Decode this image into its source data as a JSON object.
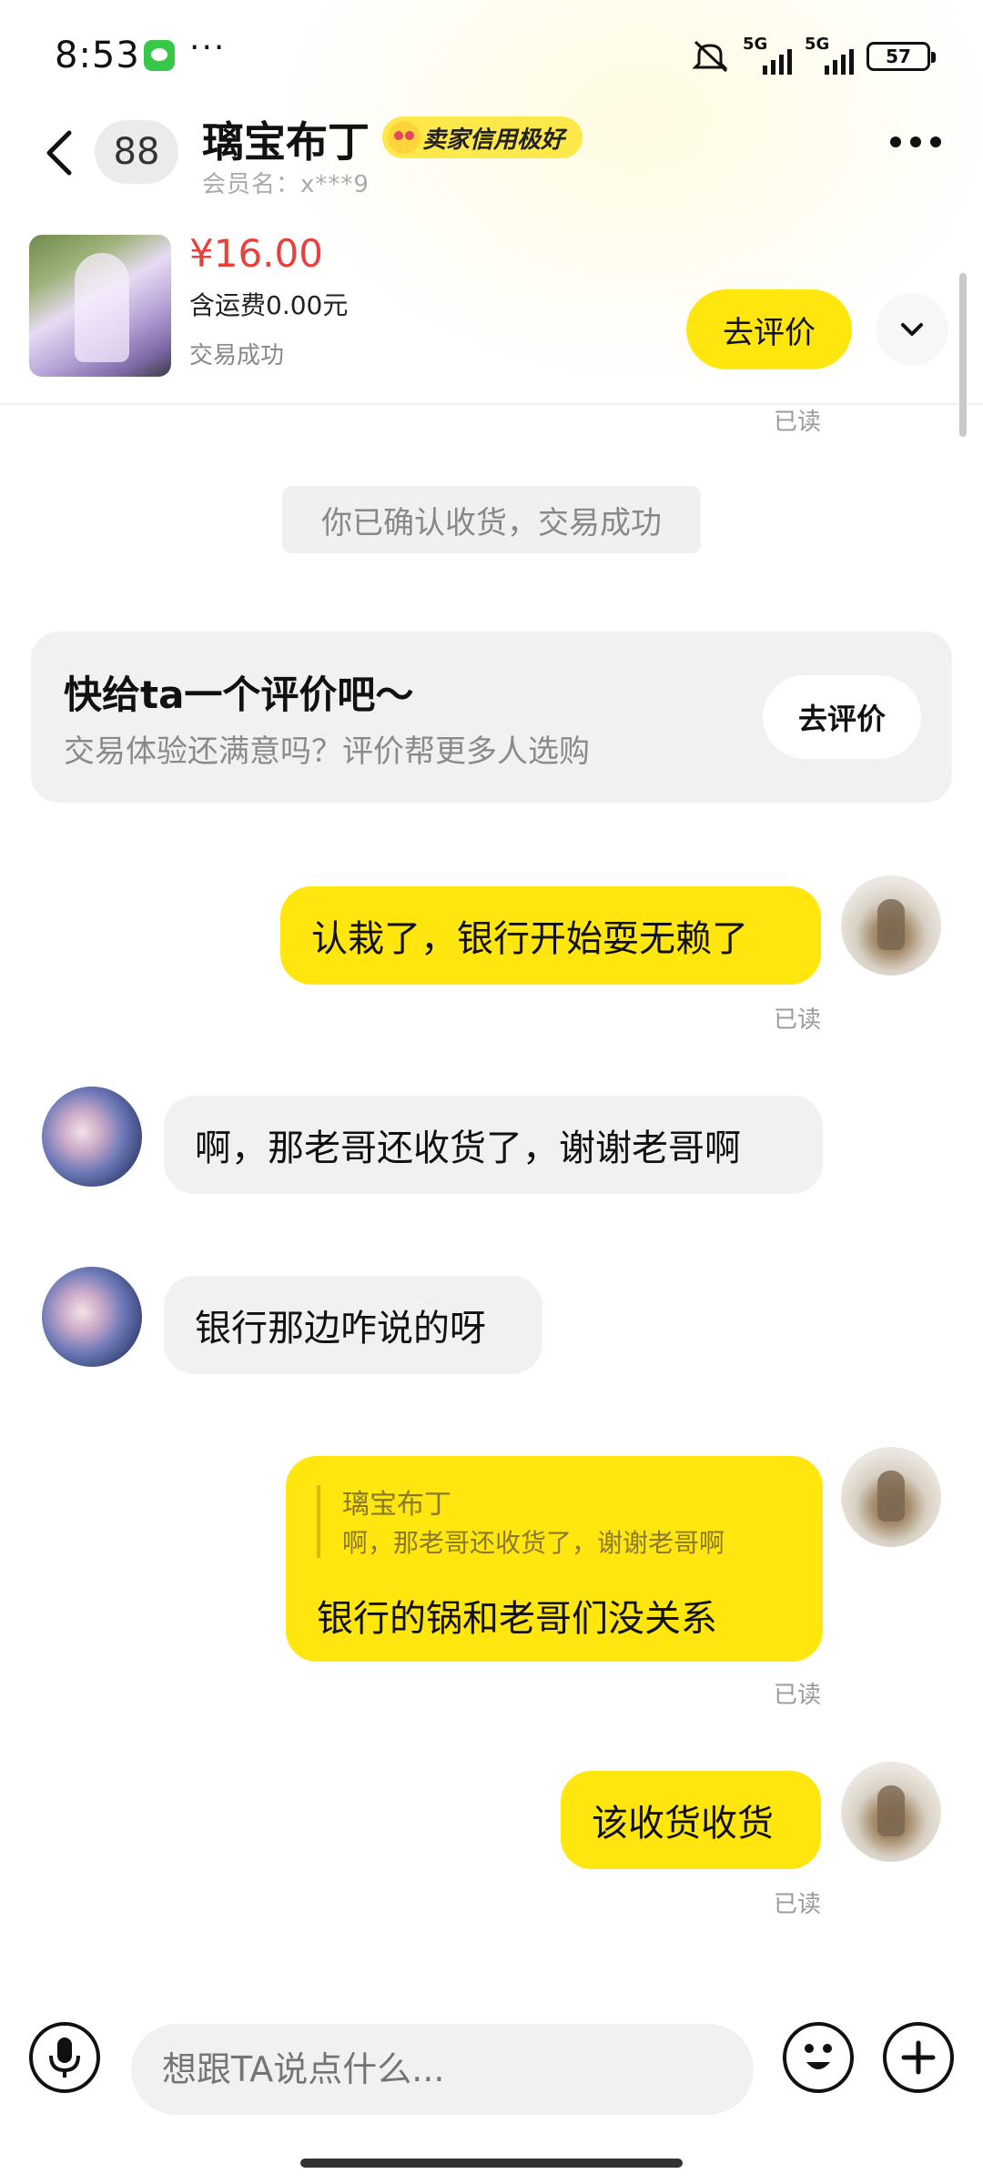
{
  "status_bar": {
    "time": "8:53",
    "more": "···",
    "signal1": "5G",
    "signal2": "5G",
    "battery": "57"
  },
  "header": {
    "unread_count": "88",
    "seller_name": "璃宝布丁",
    "credit_badge": "卖家信用极好",
    "member_label": "会员名：x***9"
  },
  "product": {
    "price": "¥16.00",
    "shipping": "含运费0.00元",
    "status": "交易成功",
    "review_button": "去评价"
  },
  "chat": {
    "read_label": "已读",
    "system_message": "你已确认收货，交易成功",
    "prompt": {
      "title": "快给ta一个评价吧～",
      "subtitle": "交易体验还满意吗？评价帮更多人选购",
      "button": "去评价"
    },
    "messages": [
      {
        "sender": "me",
        "text": "认栽了，银行开始耍无赖了"
      },
      {
        "sender": "them",
        "text": "啊，那老哥还收货了，谢谢老哥啊"
      },
      {
        "sender": "them",
        "text": "银行那边咋说的呀"
      },
      {
        "sender": "me",
        "quote_name": "璃宝布丁",
        "quote_text": "啊，那老哥还收货了，谢谢老哥啊",
        "text": "银行的锅和老哥们没关系"
      },
      {
        "sender": "me",
        "text": "该收货收货"
      }
    ]
  },
  "input": {
    "placeholder": "想跟TA说点什么..."
  },
  "colors": {
    "accent_yellow": "#ffe60f",
    "price_red": "#e8403a",
    "bubble_gray": "#f1f1f3"
  },
  "icons": [
    "back-icon",
    "wechat-icon",
    "mute-icon",
    "menu-icon",
    "chevron-down-icon",
    "mic-icon",
    "emoji-icon",
    "plus-icon"
  ]
}
